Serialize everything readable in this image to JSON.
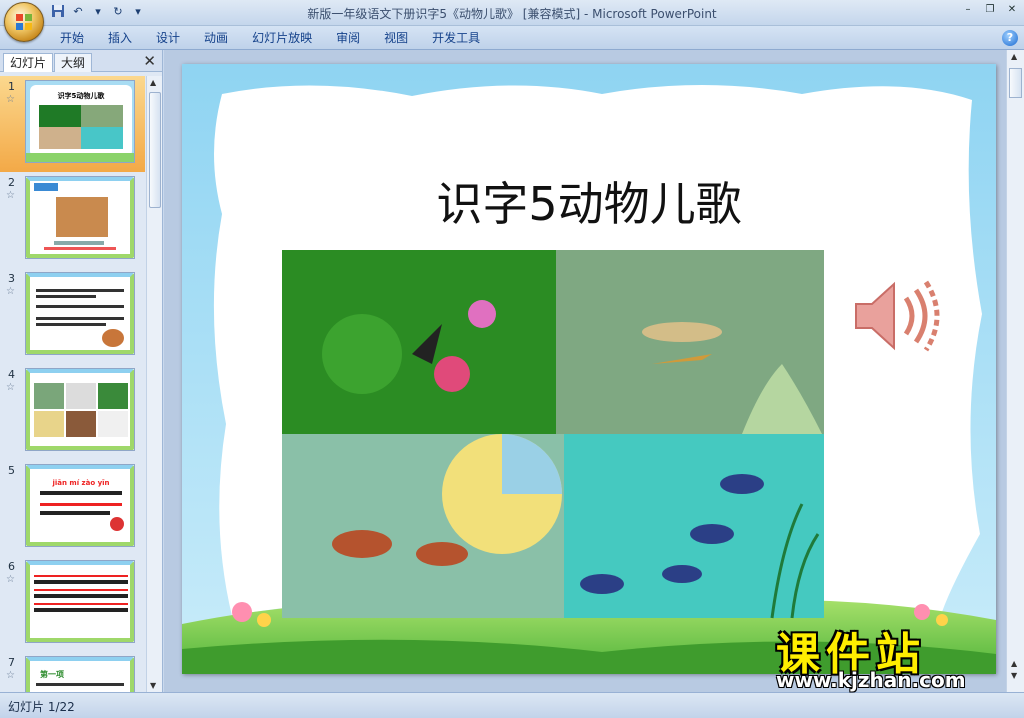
{
  "window": {
    "title": "新版一年级语文下册识字5《动物儿歌》 [兼容模式] - Microsoft PowerPoint"
  },
  "ribbon": {
    "tabs": [
      "开始",
      "插入",
      "设计",
      "动画",
      "幻灯片放映",
      "审阅",
      "视图",
      "开发工具"
    ]
  },
  "left_panel": {
    "tabs": [
      "幻灯片",
      "大纲"
    ],
    "slides": [
      {
        "number": "1",
        "title": "识字5动物儿歌"
      },
      {
        "number": "2",
        "title": ""
      },
      {
        "number": "3",
        "title": ""
      },
      {
        "number": "4",
        "title": ""
      },
      {
        "number": "5",
        "title": "jiān mí zào yīn"
      },
      {
        "number": "6",
        "title": ""
      },
      {
        "number": "7",
        "title": "第一项"
      }
    ]
  },
  "slide": {
    "title": "识字5动物儿歌"
  },
  "status": {
    "slide_counter": "幻灯片 1/22"
  },
  "watermark": {
    "name": "课件站",
    "url": "www.kjzhan.com"
  },
  "icons": {
    "office_button": "office-logo-icon",
    "save": "save-icon",
    "undo": "undo-icon",
    "redo": "redo-icon",
    "help": "help-icon",
    "speaker": "speaker-icon",
    "close": "close-icon"
  },
  "colors": {
    "ribbon_text": "#15428b",
    "slide_bg": "#a8dcf3",
    "selected_thumb": "#f3a947",
    "watermark_yellow": "#ffee00"
  }
}
